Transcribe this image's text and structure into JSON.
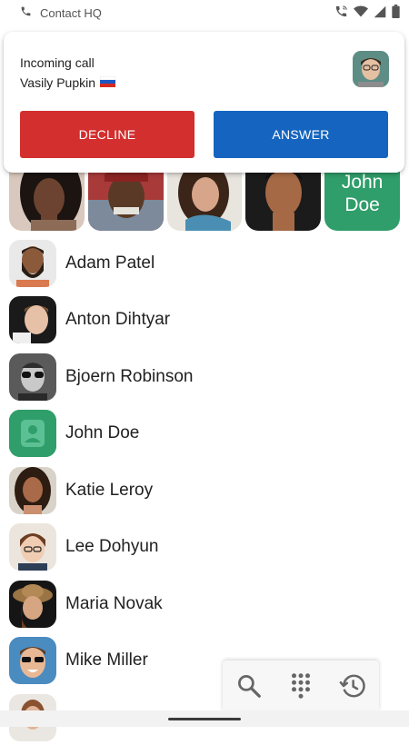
{
  "status_bar": {
    "app_label": "Contact HQ"
  },
  "incoming_call": {
    "title": "Incoming call",
    "caller_name": "Vasily Pupkin",
    "caller_flag": "🇷🇺",
    "decline_label": "DECLINE",
    "answer_label": "ANSWER",
    "decline_color": "#d32f2f",
    "answer_color": "#1565c0"
  },
  "favorites": {
    "text_tile": {
      "line1": "John",
      "line2": "Doe"
    },
    "accent": "#2f9e6a"
  },
  "contacts": [
    {
      "name": "Adam Patel"
    },
    {
      "name": "Anton Dihtyar"
    },
    {
      "name": "Bjoern Robinson"
    },
    {
      "name": "John Doe"
    },
    {
      "name": "Katie Leroy"
    },
    {
      "name": "Lee Dohyun"
    },
    {
      "name": "Maria Novak"
    },
    {
      "name": "Mike Miller"
    }
  ],
  "toolbar": {
    "icons": [
      "search-icon",
      "dialpad-icon",
      "history-icon"
    ]
  }
}
